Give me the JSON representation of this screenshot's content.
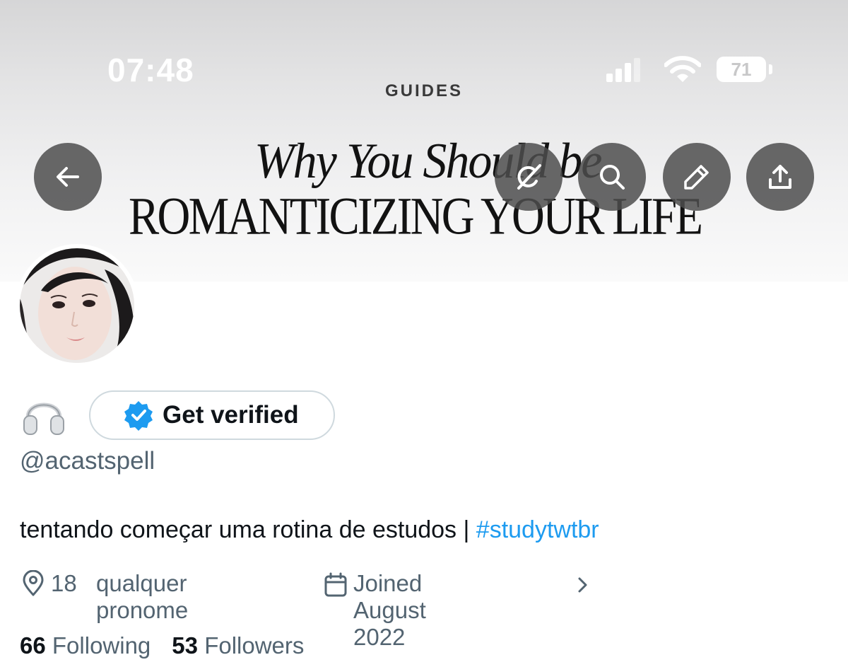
{
  "status_bar": {
    "time": "07:48",
    "battery": "71"
  },
  "banner": {
    "section_label": "GUIDES",
    "headline_line1": "Why You Should be",
    "headline_line2": "ROMANTICIZING YOUR LIFE"
  },
  "header_buttons": {
    "back": "back-arrow-icon",
    "grok": "grok-icon",
    "search": "search-icon",
    "edit": "pencil-icon",
    "share": "share-icon"
  },
  "profile": {
    "display_name_emoji": "headphones-icon",
    "get_verified_label": "Get verified",
    "handle": "@acastspell",
    "bio_text": "tentando começar uma rotina de estudos | ",
    "bio_hashtag": "#studytwtbr",
    "location": "18",
    "pronouns": "qualquer pronome",
    "joined": "Joined August 2022",
    "following_count": "66",
    "following_label": "Following",
    "followers_count": "53",
    "followers_label": "Followers"
  },
  "colors": {
    "accent": "#1d9bf0",
    "secondary_text": "#536471",
    "button_overlay": "#4e4e4e"
  }
}
